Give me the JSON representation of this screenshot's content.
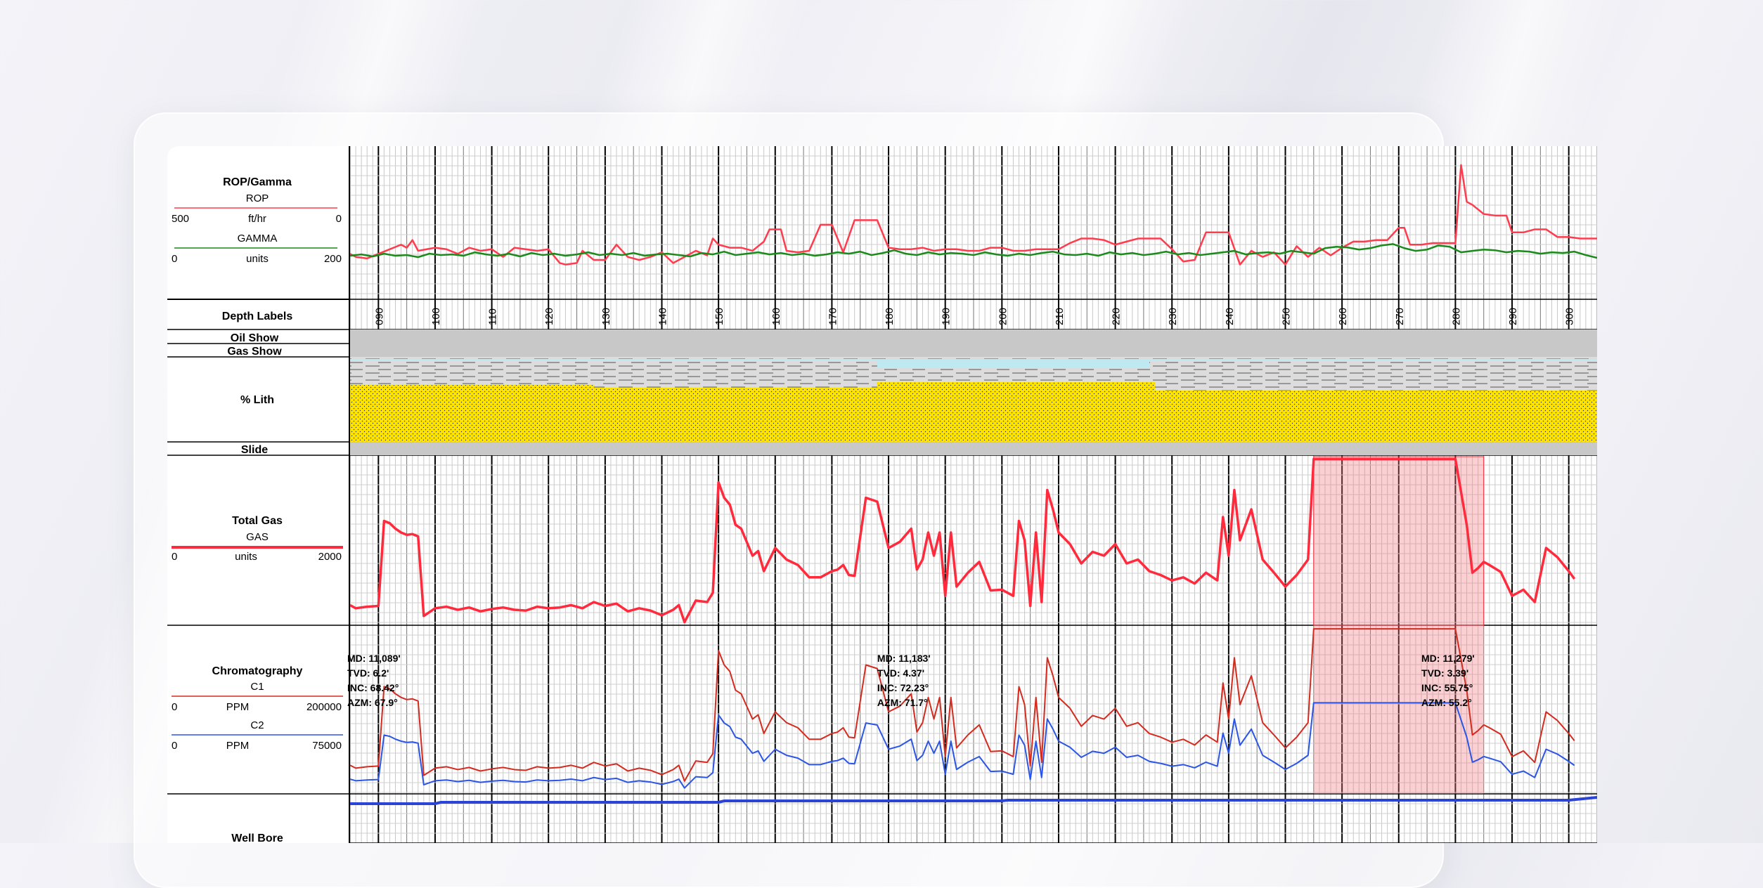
{
  "tracks": {
    "rop_gamma": {
      "title": "ROP/Gamma",
      "rop": {
        "name": "ROP",
        "min": "500",
        "unit": "ft/hr",
        "max": "0",
        "color": "#ff3b4e"
      },
      "gamma": {
        "name": "GAMMA",
        "min": "0",
        "unit": "units",
        "max": "200",
        "color": "#1a8a1a"
      }
    },
    "depth_labels": {
      "title": "Depth Labels"
    },
    "oil_show": {
      "title": "Oil Show"
    },
    "gas_show": {
      "title": "Gas Show"
    },
    "lith": {
      "title": "% Lith",
      "sand_color": "#ffe400",
      "shale_color": "#dcdcdc",
      "limestone_color": "#bfe9f2"
    },
    "slide": {
      "title": "Slide"
    },
    "total_gas": {
      "title": "Total Gas",
      "gas": {
        "name": "GAS",
        "min": "0",
        "unit": "units",
        "max": "2000",
        "color": "#ff2a3c"
      }
    },
    "chromatography": {
      "title": "Chromatography",
      "c1": {
        "name": "C1",
        "min": "0",
        "unit": "PPM",
        "max": "200000",
        "color": "#d42b1e"
      },
      "c2": {
        "name": "C2",
        "min": "0",
        "unit": "PPM",
        "max": "75000",
        "color": "#2b55e6"
      }
    },
    "well_bore": {
      "title": "Well Bore",
      "color": "#2b44d6"
    }
  },
  "survey_labels": [
    {
      "md": "MD: 11,089'",
      "tvd": "TVD: 6.2'",
      "inc": "INC: 68.42°",
      "azm": "AZM: 67.9°"
    },
    {
      "md": "MD: 11,183'",
      "tvd": "TVD: 4.37'",
      "inc": "INC: 72.23°",
      "azm": "AZM: 71.7°"
    },
    {
      "md": "MD: 11,279'",
      "tvd": "TVD: 3.39'",
      "inc": "INC: 55.75°",
      "azm": "AZM: 55.2°"
    }
  ],
  "chart_data": {
    "type": "line",
    "x_axis": "depth",
    "depth_ticks": [
      "090",
      "100",
      "110",
      "120",
      "130",
      "140",
      "150",
      "160",
      "170",
      "180",
      "190",
      "200",
      "210",
      "220",
      "230",
      "240",
      "250",
      "260",
      "270",
      "280",
      "290",
      "300"
    ],
    "depth_range": [
      85,
      305
    ],
    "grid": true,
    "rop": {
      "range": [
        500,
        0
      ],
      "x": [
        85,
        86,
        88,
        90,
        92,
        94,
        95,
        96,
        97,
        100,
        102,
        104,
        106,
        108,
        110,
        112,
        114,
        118,
        120,
        122,
        123,
        125,
        126,
        128,
        130,
        132,
        134,
        136,
        138,
        140,
        142,
        144,
        146,
        148,
        149,
        150,
        152,
        154,
        156,
        158,
        159,
        161,
        162,
        164,
        166,
        168,
        170,
        172,
        174,
        176,
        178,
        180,
        182,
        184,
        186,
        188,
        190,
        192,
        194,
        196,
        198,
        200,
        202,
        204,
        206,
        208,
        210,
        212,
        214,
        216,
        218,
        220,
        222,
        224,
        226,
        228,
        230,
        232,
        234,
        236,
        238,
        240,
        242,
        244,
        246,
        248,
        250,
        252,
        254,
        256,
        258,
        260,
        262,
        264,
        266,
        268,
        270,
        271,
        272,
        274,
        276,
        278,
        280,
        281,
        282,
        283,
        285,
        287,
        289,
        290,
        292,
        294,
        296,
        298,
        300,
        302,
        305
      ],
      "y": [
        130,
        120,
        115,
        130,
        145,
        160,
        150,
        175,
        140,
        150,
        145,
        130,
        150,
        140,
        145,
        120,
        150,
        140,
        145,
        100,
        95,
        100,
        140,
        110,
        110,
        160,
        120,
        110,
        120,
        135,
        100,
        120,
        140,
        125,
        180,
        160,
        150,
        150,
        140,
        170,
        210,
        210,
        140,
        135,
        140,
        225,
        225,
        135,
        240,
        240,
        240,
        150,
        145,
        145,
        150,
        140,
        145,
        145,
        140,
        140,
        150,
        150,
        140,
        140,
        145,
        145,
        145,
        165,
        180,
        180,
        175,
        160,
        170,
        180,
        180,
        180,
        145,
        105,
        110,
        200,
        200,
        200,
        95,
        140,
        120,
        135,
        95,
        155,
        120,
        150,
        125,
        150,
        170,
        170,
        175,
        175,
        215,
        215,
        160,
        160,
        165,
        165,
        165,
        420,
        300,
        290,
        260,
        255,
        255,
        200,
        200,
        210,
        210,
        185,
        185,
        180,
        180
      ]
    },
    "gamma": {
      "range": [
        0,
        200
      ],
      "x": [
        85,
        87,
        89,
        91,
        93,
        95,
        97,
        99,
        101,
        103,
        105,
        107,
        109,
        111,
        113,
        115,
        117,
        119,
        121,
        123,
        125,
        127,
        129,
        131,
        133,
        135,
        137,
        139,
        141,
        143,
        145,
        147,
        149,
        151,
        153,
        155,
        157,
        159,
        161,
        163,
        165,
        167,
        169,
        171,
        173,
        175,
        177,
        179,
        181,
        183,
        185,
        187,
        189,
        191,
        193,
        195,
        197,
        199,
        201,
        203,
        205,
        207,
        209,
        211,
        213,
        215,
        217,
        219,
        221,
        223,
        225,
        227,
        229,
        231,
        233,
        235,
        237,
        239,
        241,
        243,
        245,
        247,
        249,
        251,
        253,
        255,
        257,
        259,
        261,
        263,
        265,
        267,
        269,
        271,
        273,
        275,
        277,
        279,
        281,
        283,
        285,
        287,
        289,
        291,
        293,
        295,
        297,
        299,
        301,
        303,
        305
      ],
      "y": [
        55,
        57,
        54,
        58,
        55,
        56,
        53,
        58,
        56,
        57,
        55,
        60,
        57,
        55,
        58,
        54,
        59,
        56,
        58,
        55,
        57,
        60,
        56,
        58,
        56,
        59,
        55,
        57,
        58,
        56,
        54,
        59,
        57,
        61,
        56,
        58,
        60,
        57,
        59,
        56,
        58,
        55,
        57,
        60,
        58,
        61,
        56,
        59,
        63,
        58,
        56,
        60,
        57,
        59,
        58,
        56,
        60,
        57,
        55,
        58,
        56,
        59,
        61,
        57,
        56,
        58,
        55,
        60,
        57,
        59,
        56,
        58,
        61,
        57,
        59,
        56,
        58,
        60,
        62,
        57,
        59,
        60,
        58,
        62,
        60,
        58,
        66,
        68,
        67,
        64,
        66,
        70,
        72,
        66,
        62,
        64,
        70,
        68,
        60,
        62,
        64,
        63,
        60,
        62,
        61,
        58,
        60,
        59,
        61,
        56,
        52
      ]
    },
    "total_gas": {
      "range": [
        0,
        2000
      ],
      "x": [
        85,
        86,
        88,
        90,
        91,
        92,
        93,
        94,
        95,
        96,
        97,
        98,
        100,
        102,
        104,
        106,
        108,
        110,
        112,
        114,
        116,
        118,
        120,
        122,
        124,
        126,
        128,
        130,
        132,
        134,
        136,
        138,
        140,
        142,
        143,
        144,
        146,
        148,
        149,
        150,
        151,
        152,
        153,
        154,
        156,
        157,
        158,
        160,
        162,
        164,
        166,
        168,
        170,
        171,
        172,
        173,
        174,
        176,
        178,
        180,
        182,
        184,
        185,
        186,
        187,
        188,
        189,
        190,
        191,
        192,
        194,
        196,
        198,
        200,
        202,
        203,
        204,
        205,
        206,
        207,
        208,
        209,
        210,
        212,
        214,
        216,
        218,
        220,
        222,
        224,
        226,
        228,
        230,
        232,
        234,
        236,
        238,
        239,
        240,
        241,
        242,
        244,
        246,
        248,
        250,
        252,
        254,
        255,
        256,
        257,
        258,
        259,
        260,
        262,
        264,
        266,
        268,
        270,
        272,
        274,
        276,
        278,
        280,
        282,
        283,
        284,
        285,
        286,
        288,
        290,
        292,
        294,
        296,
        298,
        300,
        301,
        302,
        304,
        305
      ],
      "y": [
        260,
        220,
        240,
        250,
        1350,
        1320,
        1250,
        1200,
        1170,
        1180,
        1150,
        120,
        220,
        240,
        200,
        230,
        180,
        210,
        230,
        200,
        190,
        240,
        220,
        230,
        260,
        220,
        300,
        250,
        280,
        180,
        220,
        190,
        130,
        200,
        260,
        40,
        320,
        300,
        420,
        1850,
        1650,
        1560,
        1300,
        1250,
        900,
        960,
        700,
        1000,
        850,
        780,
        620,
        620,
        700,
        720,
        780,
        650,
        640,
        1650,
        1600,
        1000,
        1080,
        1250,
        720,
        850,
        1200,
        900,
        1200,
        380,
        1200,
        500,
        680,
        820,
        450,
        460,
        380,
        1350,
        1100,
        250,
        1200,
        300,
        1750,
        1500,
        1200,
        1050,
        800,
        950,
        900,
        1050,
        800,
        850,
        700,
        650,
        580,
        620,
        540,
        680,
        580,
        1400,
        900,
        1750,
        1100,
        1500,
        850,
        680,
        500,
        650,
        850,
        2150,
        2150,
        2150,
        2150,
        2150,
        2150,
        2150,
        2150,
        2150,
        2150,
        2150,
        2150,
        2150,
        2150,
        2150,
        2150,
        1300,
        680,
        740,
        820,
        780,
        690,
        380,
        460,
        300,
        1000,
        880,
        700,
        600
      ]
    }
  }
}
